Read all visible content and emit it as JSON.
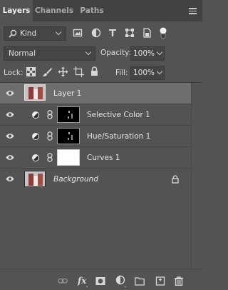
{
  "tabs": [
    {
      "label": "Layers",
      "active": true
    },
    {
      "label": "Channels",
      "active": false
    },
    {
      "label": "Paths",
      "active": false
    }
  ],
  "filter": {
    "kind_value": "Kind",
    "icons": [
      "pixel-filter-icon",
      "adjustment-filter-icon",
      "type-filter-icon",
      "shape-filter-icon",
      "smart-object-filter-icon",
      "filter-toggle-icon"
    ]
  },
  "blend": {
    "mode": "Normal",
    "opacity_label": "Opacity:",
    "opacity_value": "100%"
  },
  "lock": {
    "label": "Lock:",
    "fill_label": "Fill:",
    "fill_value": "100%",
    "icons": [
      "lock-transparency-icon",
      "lock-pixels-icon",
      "lock-position-icon",
      "artboard-lock-icon",
      "lock-all-icon"
    ]
  },
  "layers": [
    {
      "name": "Layer 1",
      "type": "pixel",
      "selected": true,
      "italic": false
    },
    {
      "name": "Selective Color 1",
      "type": "adjustment",
      "selected": false,
      "italic": false
    },
    {
      "name": "Hue/Saturation 1",
      "type": "adjustment",
      "selected": false,
      "italic": false
    },
    {
      "name": "Curves 1",
      "type": "adjustment",
      "selected": false,
      "italic": false
    },
    {
      "name": "Background",
      "type": "background",
      "selected": false,
      "italic": true,
      "locked": true
    }
  ],
  "footer_icons": [
    "link-layers-icon",
    "fx-icon",
    "add-mask-icon",
    "new-adjustment-icon",
    "new-group-icon",
    "new-layer-icon",
    "delete-icon"
  ],
  "colors": {
    "panel_bg": "#535353",
    "tab_bar_bg": "#424242",
    "selected_row": "#6e6e6e"
  }
}
